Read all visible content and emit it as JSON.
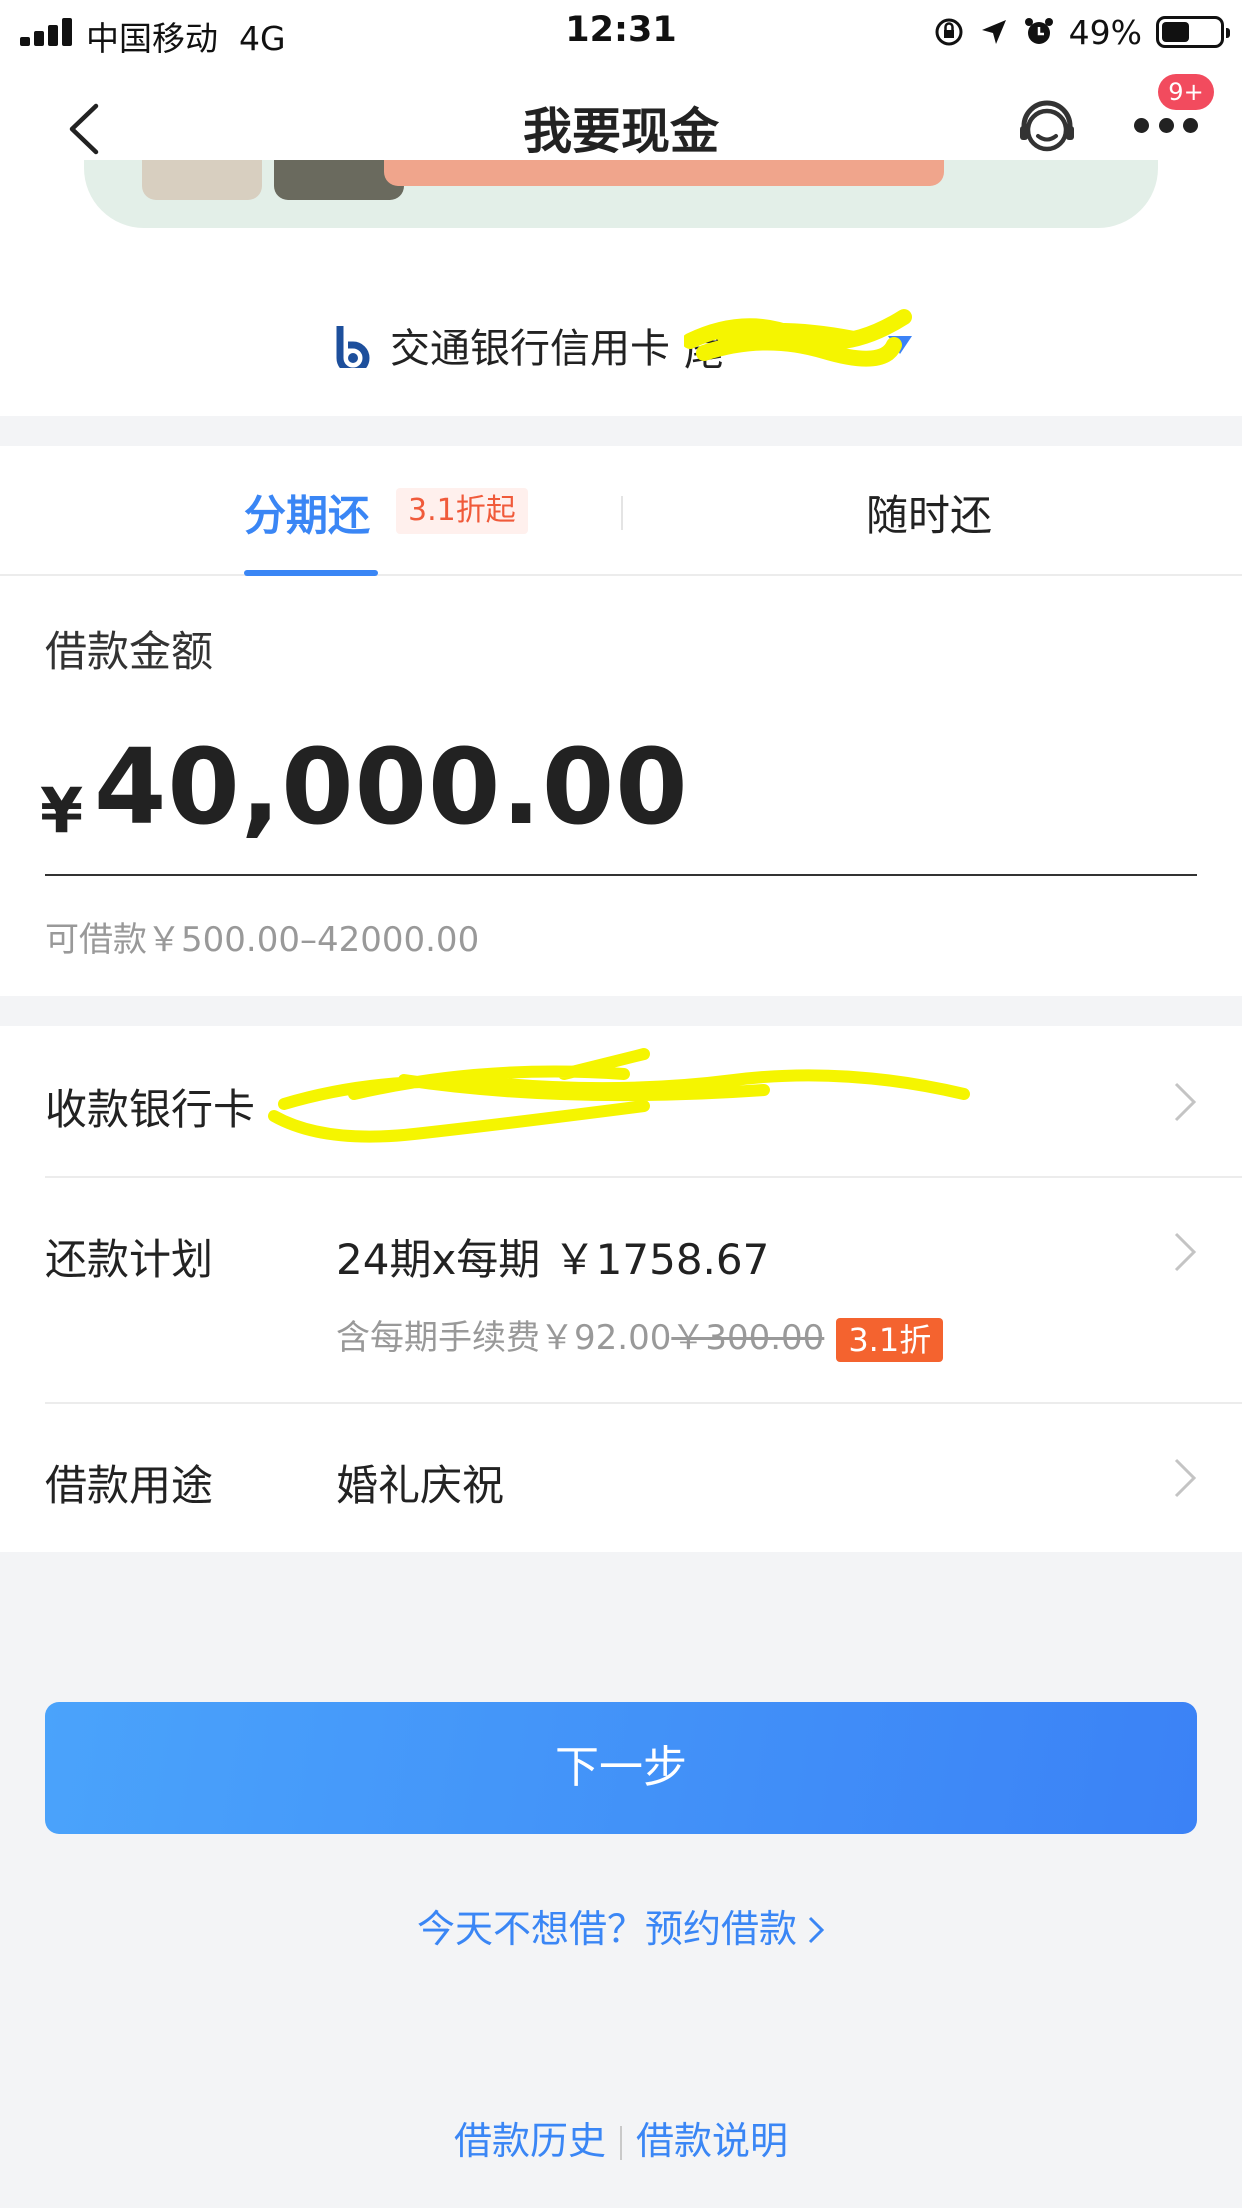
{
  "status_bar": {
    "carrier": "中国移动",
    "network": "4G",
    "time": "12:31",
    "battery_percent": "49%",
    "battery_level": 0.49
  },
  "nav": {
    "title": "我要现金",
    "badge": "9+"
  },
  "card_selector": {
    "bank_name": "交通银行信用卡",
    "tail_prefix": "尾"
  },
  "tabs": [
    {
      "label": "分期还",
      "tag": "3.1折起",
      "active": true
    },
    {
      "label": "随时还",
      "active": false
    }
  ],
  "amount": {
    "label": "借款金额",
    "currency": "¥",
    "value": "40,000.00",
    "range_text": "可借款￥500.00–42000.00"
  },
  "details": {
    "receiving_card": {
      "label": "收款银行卡"
    },
    "repay_plan": {
      "label": "还款计划",
      "value": "24期x每期 ￥1758.67",
      "fee_prefix": "含每期手续费￥92.00",
      "fee_original": "￥300.00",
      "fee_discount": "3.1折"
    },
    "purpose": {
      "label": "借款用途",
      "value": "婚礼庆祝"
    }
  },
  "actions": {
    "next": "下一步",
    "reserve": "今天不想借？预约借款"
  },
  "footer": {
    "history": "借款历史",
    "explain": "借款说明"
  },
  "colors": {
    "accent": "#3a86f5",
    "discount": "#f4632f",
    "badge": "#f24b5e",
    "highlight": "#f5f500"
  }
}
